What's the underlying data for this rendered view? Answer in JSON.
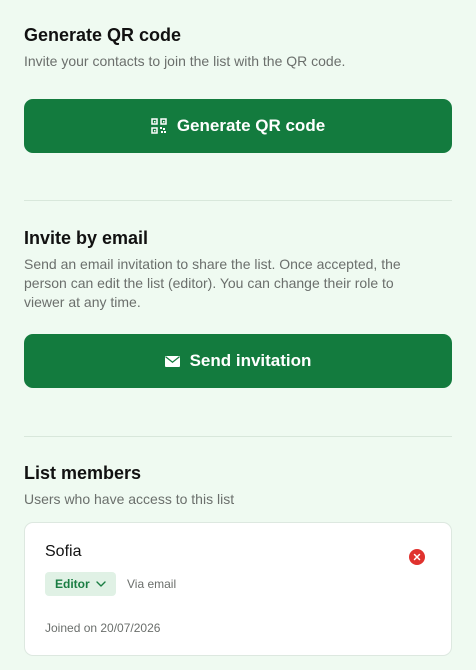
{
  "qr_section": {
    "title": "Generate QR code",
    "description": "Invite your contacts to join the list with the QR code.",
    "button_label": "Generate QR code"
  },
  "email_section": {
    "title": "Invite by email",
    "description": "Send an email invitation to share the list. Once accepted, the person can edit the list (editor). You can change their role to viewer at any time.",
    "button_label": "Send invitation"
  },
  "members_section": {
    "title": "List members",
    "description": "Users who have access to this list",
    "members": [
      {
        "name": "Sofia",
        "role": "Editor",
        "via": "Via email",
        "joined": "Joined on 20/07/2026"
      }
    ]
  },
  "colors": {
    "background": "#effaf1",
    "primary_button": "#137b3e",
    "badge_bg": "#e0f1e5",
    "badge_text": "#1a7d43",
    "remove": "#e0322e"
  },
  "icons": {
    "qr": "qr-code-icon",
    "mail": "envelope-icon",
    "remove": "remove-circle-icon",
    "chevron": "chevron-down-icon"
  }
}
